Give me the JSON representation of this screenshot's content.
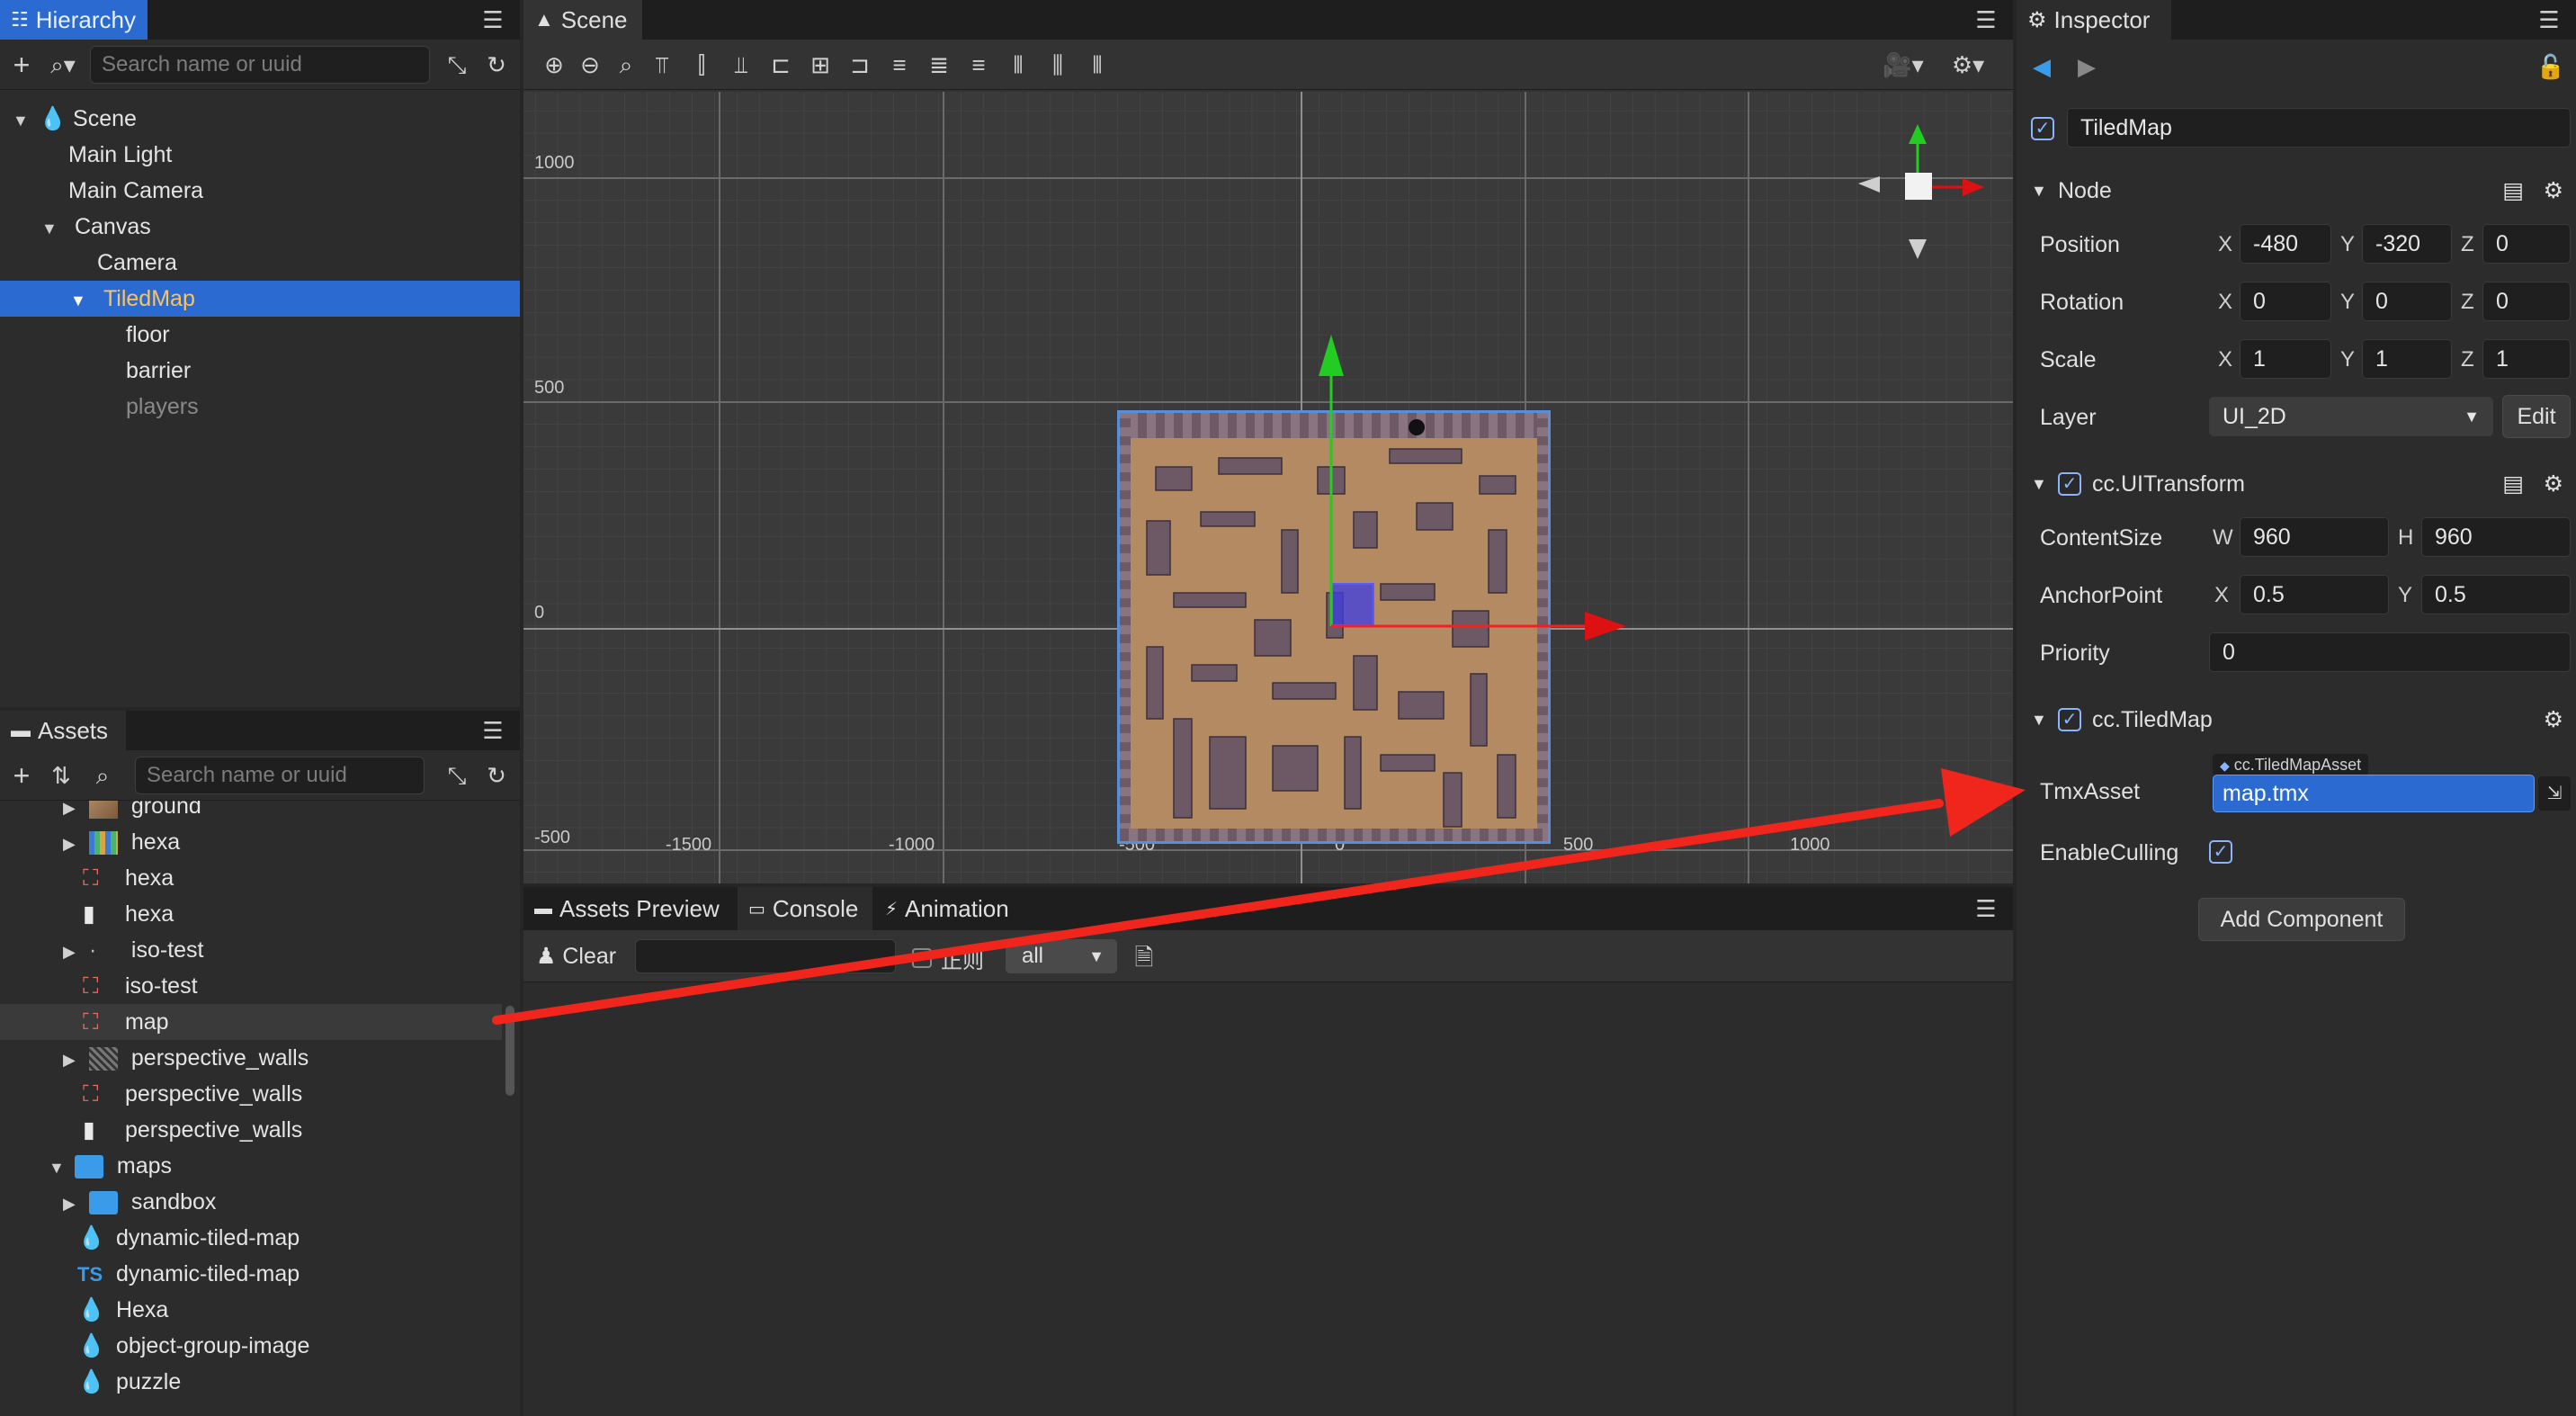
{
  "hierarchy": {
    "tab": "Hierarchy",
    "search_placeholder": "Search name or uuid",
    "nodes": [
      {
        "label": "Scene",
        "caret": "▼"
      },
      {
        "label": "Main Light"
      },
      {
        "label": "Main Camera"
      },
      {
        "label": "Canvas",
        "caret": "▼"
      },
      {
        "label": "Camera"
      },
      {
        "label": "TiledMap",
        "caret": "▼"
      },
      {
        "label": "floor"
      },
      {
        "label": "barrier"
      },
      {
        "label": "players"
      }
    ]
  },
  "assets": {
    "tab": "Assets",
    "search_placeholder": "Search name or uuid",
    "items": [
      {
        "label": "ground",
        "caret": "▶"
      },
      {
        "label": "hexa",
        "caret": "▶"
      },
      {
        "label": "hexa"
      },
      {
        "label": "hexa"
      },
      {
        "label": "iso-test",
        "caret": "▶"
      },
      {
        "label": "iso-test"
      },
      {
        "label": "map"
      },
      {
        "label": "perspective_walls",
        "caret": "▶"
      },
      {
        "label": "perspective_walls"
      },
      {
        "label": "perspective_walls"
      },
      {
        "label": "maps",
        "caret": "▼"
      },
      {
        "label": "sandbox",
        "caret": "▶"
      },
      {
        "label": "dynamic-tiled-map"
      },
      {
        "label": "dynamic-tiled-map",
        "prefix": "TS"
      },
      {
        "label": "Hexa"
      },
      {
        "label": "object-group-image"
      },
      {
        "label": "puzzle"
      }
    ]
  },
  "scene": {
    "tab": "Scene",
    "grid_labels": {
      "y1000": "1000",
      "y500": "500",
      "y0": "0",
      "ym500": "-500",
      "xm1500": "-1500",
      "xm1000": "-1000",
      "xm500": "-500",
      "x0": "0",
      "x500": "500",
      "x1000": "1000"
    }
  },
  "bottom": {
    "tabs": [
      "Assets Preview",
      "Console",
      "Animation"
    ],
    "clear_label": "Clear",
    "regex_label": "正则",
    "filter_value": "all"
  },
  "inspector": {
    "tab": "Inspector",
    "node_name": "TiledMap",
    "node_section": "Node",
    "position": {
      "label": "Position",
      "x": "-480",
      "y": "-320",
      "z": "0"
    },
    "rotation": {
      "label": "Rotation",
      "x": "0",
      "y": "0",
      "z": "0"
    },
    "scale": {
      "label": "Scale",
      "x": "1",
      "y": "1",
      "z": "1"
    },
    "layer": {
      "label": "Layer",
      "value": "UI_2D",
      "edit": "Edit"
    },
    "ui_transform": "cc.UITransform",
    "content_size": {
      "label": "ContentSize",
      "w": "960",
      "h": "960"
    },
    "anchor_point": {
      "label": "AnchorPoint",
      "x": "0.5",
      "y": "0.5"
    },
    "priority": {
      "label": "Priority",
      "value": "0"
    },
    "tiled_map": "cc.TiledMap",
    "tmx_asset": {
      "label": "TmxAsset",
      "type": "cc.TiledMapAsset",
      "value": "map.tmx"
    },
    "enable_culling": {
      "label": "EnableCulling"
    },
    "add_component": "Add Component",
    "axis": {
      "x": "X",
      "y": "Y",
      "z": "Z",
      "w": "W",
      "h": "H"
    }
  },
  "colors": {
    "selection": "#2b6bd1",
    "accent_orange": "#ffa94d",
    "annotation_arrow": "#f0261d"
  }
}
